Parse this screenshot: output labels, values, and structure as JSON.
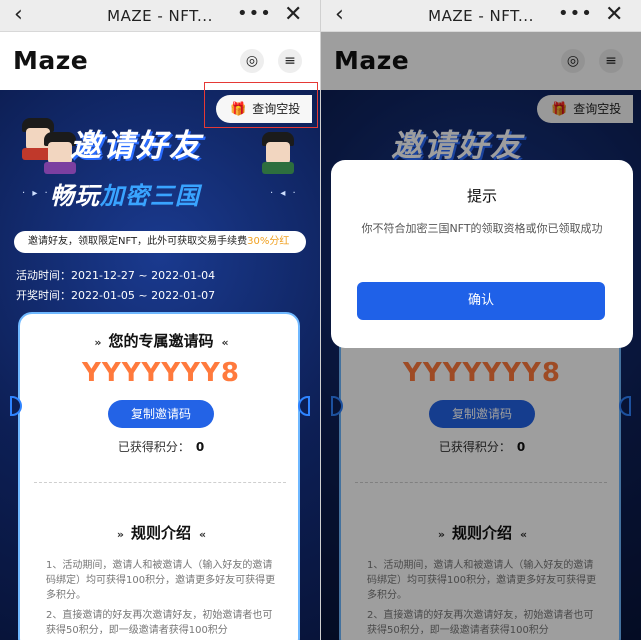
{
  "topbar": {
    "back": "‹",
    "title": "MAZE - NFT...",
    "more": "•••",
    "close": "✕"
  },
  "header": {
    "logo": "Maze",
    "globe_icon": "◎",
    "menu_icon": "≡"
  },
  "airdrop": {
    "label": "查询空投",
    "icon": "gift-icon"
  },
  "hero": {
    "title_line1": "邀请好友",
    "title_line2_white": "畅玩",
    "title_line2_blue": "加密三国",
    "banner_text": "邀请好友，领取限定NFT，此外可获取交易手续费",
    "banner_highlight": "30%分红",
    "activity_time": "活动时间：2021-12-27 ~ 2022-01-04",
    "draw_time": "开奖时间：2022-01-05 ~ 2022-01-07"
  },
  "invite": {
    "title": "您的专属邀请码",
    "code": "YYYYYYY8",
    "copy_label": "复制邀请码",
    "points_label": "已获得积分：",
    "points_value": "0"
  },
  "rules": {
    "title": "规则介绍",
    "items": [
      "1、活动期间，邀请人和被邀请人（输入好友的邀请码绑定）均可获得100积分，邀请更多好友可获得更多积分。",
      "2、直接邀请的好友再次邀请好友，初始邀请者也可获得50积分，即一级邀请者获得100积分"
    ]
  },
  "dialog": {
    "title": "提示",
    "message": "你不符合加密三国NFT的领取资格或你已领取成功",
    "confirm": "确认"
  },
  "colors": {
    "accent": "#2363e6",
    "code": "#ff7a3d",
    "highlight_box": "#e53935",
    "background": "#0d1f55"
  }
}
